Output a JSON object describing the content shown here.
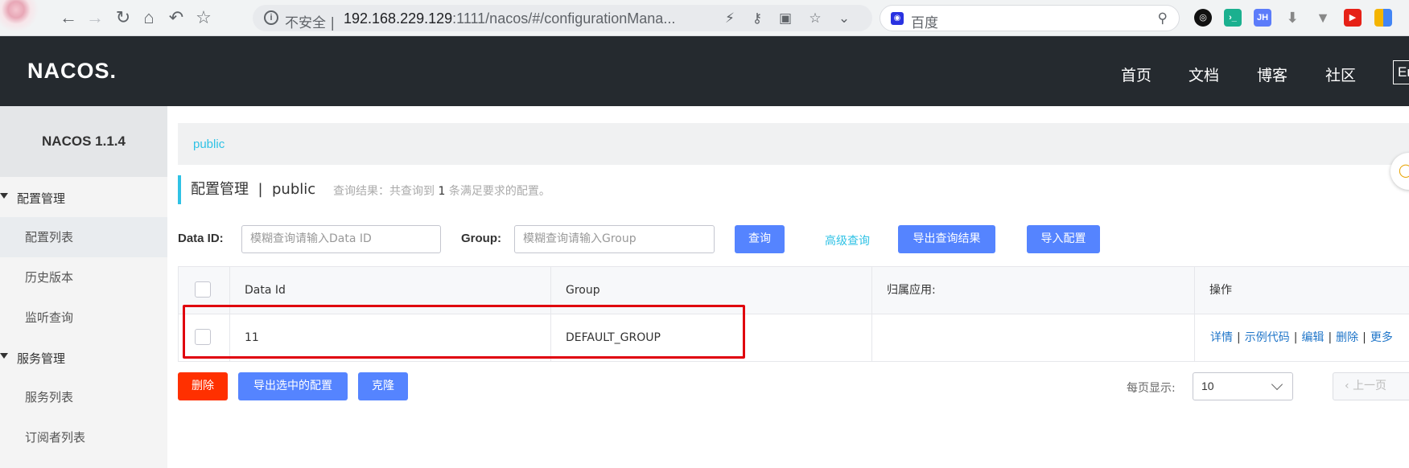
{
  "browser": {
    "security_label": "不安全",
    "url_host": "192.168.229.129",
    "url_rest": ":1111/nacos/#/configurationMana...",
    "search_placeholder": "百度",
    "icons": [
      "back-icon",
      "forward-icon",
      "reload-icon",
      "home-icon",
      "undo-icon",
      "star-icon",
      "info-icon",
      "lightning-icon",
      "key-icon",
      "translate-icon",
      "bookmark-star-icon",
      "chevron-down-icon",
      "baidu-icon",
      "search-icon"
    ],
    "extension_labels": [
      "JH"
    ]
  },
  "header": {
    "logo": "NACOS.",
    "nav": [
      "首页",
      "文档",
      "博客",
      "社区"
    ],
    "lang_label": "En"
  },
  "sidebar": {
    "version": "NACOS 1.1.4",
    "groups": [
      {
        "label": "配置管理",
        "items": [
          "配置列表",
          "历史版本",
          "监听查询"
        ]
      },
      {
        "label": "服务管理",
        "items": [
          "服务列表",
          "订阅者列表"
        ]
      }
    ]
  },
  "namespace": "public",
  "title": {
    "main": "配置管理",
    "separator": "|",
    "namespace": "public",
    "result_prefix": "查询结果：共查询到",
    "result_count": "1",
    "result_suffix": "条满足要求的配置。"
  },
  "filters": {
    "dataid_label": "Data ID:",
    "dataid_placeholder": "模糊查询请输入Data ID",
    "group_label": "Group:",
    "group_placeholder": "模糊查询请输入Group",
    "query_button": "查询",
    "advanced_link": "高级查询",
    "export_button": "导出查询结果",
    "import_button": "导入配置"
  },
  "table": {
    "columns": [
      "Data Id",
      "Group",
      "归属应用:",
      "操作"
    ],
    "rows": [
      {
        "data_id": "11",
        "group": "DEFAULT_GROUP",
        "app": "",
        "ops": [
          "详情",
          "示例代码",
          "编辑",
          "删除",
          "更多"
        ]
      }
    ]
  },
  "bulk": {
    "delete_button": "删除",
    "export_selected_button": "导出选中的配置",
    "clone_button": "克隆"
  },
  "pager": {
    "page_size_label": "每页显示:",
    "page_size": "10",
    "prev_label": "上一页"
  },
  "colors": {
    "header_bg": "#252a2f",
    "accent": "#2fc2e5",
    "primary_button": "#5584ff",
    "danger_button": "#ff3000",
    "highlight_box": "#e0000d"
  }
}
